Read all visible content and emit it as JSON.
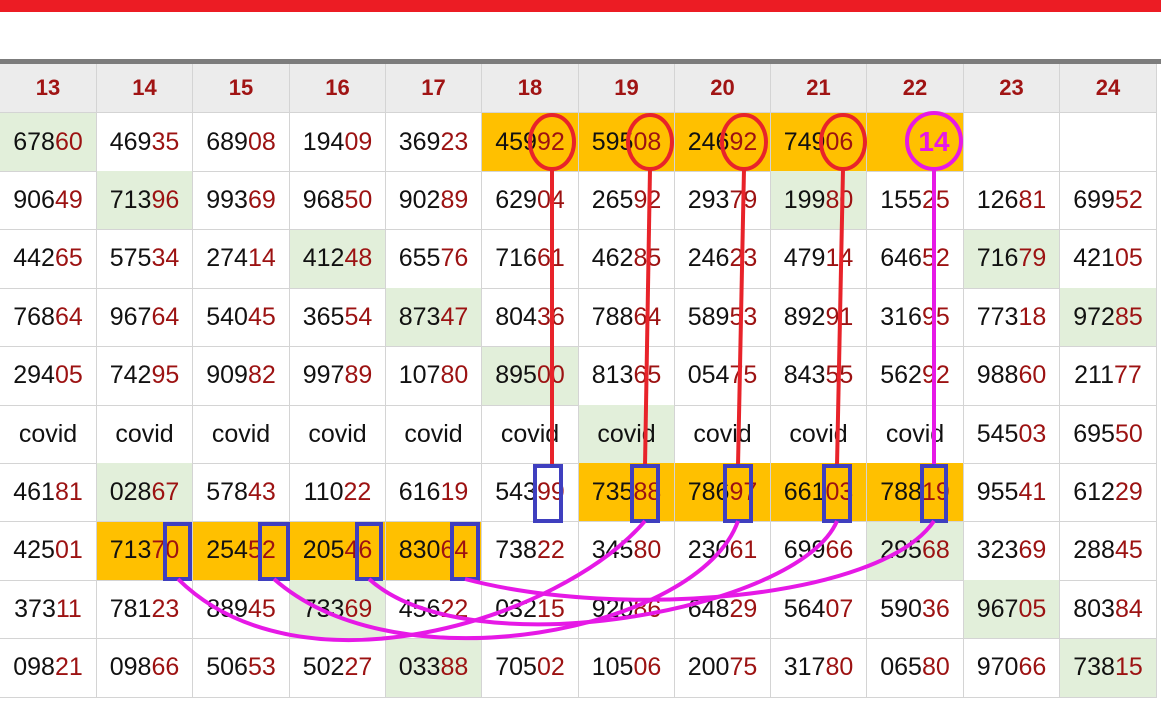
{
  "columns": [
    "13",
    "14",
    "15",
    "16",
    "17",
    "18",
    "19",
    "20",
    "21",
    "22",
    "23",
    "24"
  ],
  "rows": [
    [
      "67860",
      "46935",
      "68908",
      "19409",
      "36923",
      "45992",
      "59508",
      "24692",
      "74906",
      "",
      "",
      ""
    ],
    [
      "90649",
      "71396",
      "99369",
      "96850",
      "90289",
      "62904",
      "26592",
      "29379",
      "19980",
      "15525",
      "12681",
      "69952"
    ],
    [
      "44265",
      "57534",
      "27414",
      "41248",
      "65576",
      "71661",
      "46285",
      "24623",
      "47914",
      "64652",
      "71679",
      "42105"
    ],
    [
      "76864",
      "96764",
      "54045",
      "36554",
      "87347",
      "80436",
      "78864",
      "58953",
      "89291",
      "31695",
      "77318",
      "97285"
    ],
    [
      "29405",
      "74295",
      "90982",
      "99789",
      "10780",
      "89500",
      "81365",
      "05475",
      "84355",
      "56292",
      "98860",
      "21177"
    ],
    [
      "covid",
      "covid",
      "covid",
      "covid",
      "covid",
      "covid",
      "covid",
      "covid",
      "covid",
      "covid",
      "54503",
      "69550"
    ],
    [
      "46181",
      "02867",
      "57843",
      "11022",
      "61619",
      "54399",
      "73588",
      "78697",
      "66103",
      "78819",
      "95541",
      "61229"
    ],
    [
      "42501",
      "71370",
      "25452",
      "20546",
      "83064",
      "73822",
      "34580",
      "23061",
      "69966",
      "29568",
      "32369",
      "28845"
    ],
    [
      "37311",
      "78123",
      "88945",
      "73369",
      "45622",
      "03215",
      "92086",
      "64829",
      "56407",
      "59036",
      "96705",
      "80384"
    ],
    [
      "09821",
      "09866",
      "50653",
      "50227",
      "03388",
      "70502",
      "10506",
      "20075",
      "31780",
      "06580",
      "97066",
      "73815"
    ]
  ],
  "annotation": {
    "circle_label": "14",
    "colors": {
      "red": "#e8232a",
      "blue": "#3f3fbf",
      "magenta": "#e619e6"
    }
  },
  "colors": {
    "header_text": "#a01414",
    "digit_suffix": "#9c1212",
    "highlight_orange": "#ffc000",
    "highlight_green": "#e2efda",
    "top_bar": "#ec1c24"
  }
}
